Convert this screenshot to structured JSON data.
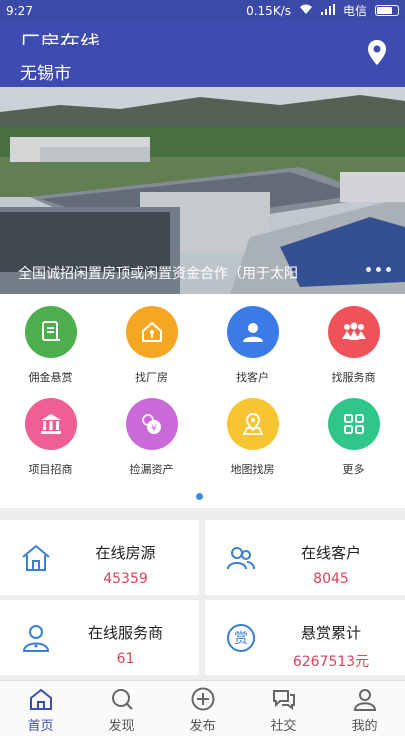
{
  "status_bar": {
    "time": "9:27",
    "network_speed": "0.15K/s",
    "carrier": "电信"
  },
  "header": {
    "app_title": "厂房在线",
    "city": "无锡市"
  },
  "banner": {
    "caption": "全国诚招闲置房顶或闲置资金合作（用于太阳"
  },
  "menu": {
    "items": [
      {
        "label": "佣金悬赏",
        "icon": "commission-icon",
        "color": "#4cae4c"
      },
      {
        "label": "找厂房",
        "icon": "factory-house-icon",
        "color": "#f5a623"
      },
      {
        "label": "找客户",
        "icon": "customer-icon",
        "color": "#3b7be8"
      },
      {
        "label": "找服务商",
        "icon": "service-people-icon",
        "color": "#f0525a"
      },
      {
        "label": "项目招商",
        "icon": "bank-building-icon",
        "color": "#ef5f93"
      },
      {
        "label": "捡漏资产",
        "icon": "money-bag-icon",
        "color": "#c96ad8"
      },
      {
        "label": "地图找房",
        "icon": "map-pin-icon",
        "color": "#f7c531"
      },
      {
        "label": "更多",
        "icon": "grid-more-icon",
        "color": "#2fc68a"
      }
    ]
  },
  "stats": [
    {
      "title": "在线房源",
      "value": "45359",
      "icon": "house-outline-icon"
    },
    {
      "title": "在线客户",
      "value": "8045",
      "icon": "users-outline-icon"
    },
    {
      "title": "在线服务商",
      "value": "61",
      "icon": "person-outline-icon"
    },
    {
      "title": "悬赏累计",
      "value": "6267513元",
      "icon": "reward-circle-icon"
    }
  ],
  "bottom_nav": [
    {
      "label": "首页",
      "icon": "home-icon",
      "active": true
    },
    {
      "label": "发现",
      "icon": "discover-icon",
      "active": false
    },
    {
      "label": "发布",
      "icon": "add-circle-icon",
      "active": false
    },
    {
      "label": "社交",
      "icon": "chat-icon",
      "active": false
    },
    {
      "label": "我的",
      "icon": "profile-icon",
      "active": false
    }
  ],
  "colors": {
    "header": "#3e4cb2",
    "accent_red": "#d9435b",
    "nav_active": "#3e4cb2"
  }
}
